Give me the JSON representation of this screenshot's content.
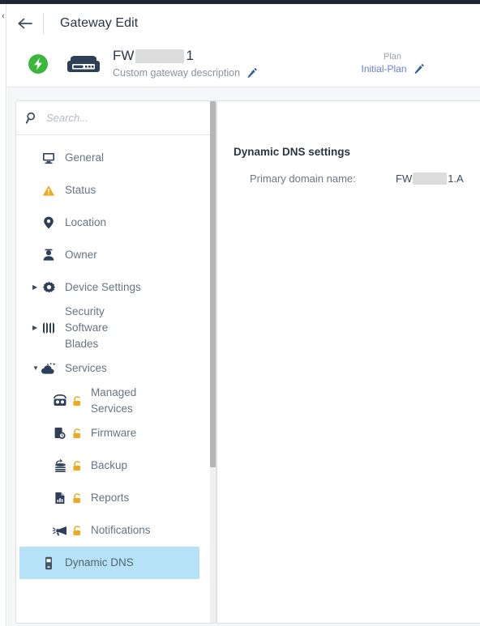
{
  "header": {
    "back_icon": "arrow-left-icon",
    "title": "Gateway Edit",
    "rail_collapse_icon": "chevron-left-icon"
  },
  "gateway": {
    "status_icon": "green-lightning-status-icon",
    "device_icon": "gateway-appliance-icon",
    "name_prefix": "FW",
    "name_suffix": "1",
    "description": "Custom gateway description",
    "description_edit_icon": "pencil-icon",
    "plan_label": "Plan",
    "plan_value": "Initial-Plan",
    "plan_edit_icon": "pencil-icon"
  },
  "sidebar": {
    "search": {
      "icon": "search-icon",
      "placeholder": "Search...",
      "value": ""
    },
    "items": [
      {
        "label": "General",
        "icon": "monitor-icon",
        "locked": false,
        "expandable": false,
        "selected": false
      },
      {
        "label": "Status",
        "icon": "warning-triangle-icon",
        "locked": false,
        "expandable": false,
        "selected": false
      },
      {
        "label": "Location",
        "icon": "map-pin-icon",
        "locked": false,
        "expandable": false,
        "selected": false
      },
      {
        "label": "Owner",
        "icon": "user-icon",
        "locked": false,
        "expandable": false,
        "selected": false
      },
      {
        "label": "Device Settings",
        "icon": "gear-icon",
        "locked": false,
        "expandable": true,
        "expanded": false,
        "selected": false
      },
      {
        "label": "Security Software Blades",
        "icon": "blades-icon",
        "locked": false,
        "expandable": true,
        "expanded": false,
        "selected": false
      },
      {
        "label": "Services",
        "icon": "cloud-services-icon",
        "locked": false,
        "expandable": true,
        "expanded": true,
        "selected": false
      }
    ],
    "sub_items": [
      {
        "label": "Managed Services",
        "icon": "managed-services-icon",
        "locked": true,
        "selected": false
      },
      {
        "label": "Firmware",
        "icon": "firmware-icon",
        "locked": true,
        "selected": false
      },
      {
        "label": "Backup",
        "icon": "backup-icon",
        "locked": true,
        "selected": false
      },
      {
        "label": "Reports",
        "icon": "reports-icon",
        "locked": true,
        "selected": false
      },
      {
        "label": "Notifications",
        "icon": "megaphone-icon",
        "locked": true,
        "selected": false
      },
      {
        "label": "Dynamic DNS",
        "icon": "dynamic-dns-icon",
        "locked": false,
        "selected": true
      }
    ]
  },
  "content": {
    "heading": "Dynamic DNS settings",
    "fields": [
      {
        "label": "Primary domain name:",
        "value_prefix": "FW",
        "value_suffix": "1.A"
      }
    ]
  },
  "colors": {
    "status_green": "#3db63d",
    "device_navy": "#2e4057",
    "lock_amber": "#f0a81e",
    "warning_amber": "#f0a81e",
    "selection_blue": "#b6e2f7",
    "link_blue": "#6a7fd0",
    "pencil_blue": "#2c5f9e",
    "text_dark": "#2a3645",
    "text_muted": "#8a939e",
    "redaction_gray": "#dcdcdc"
  }
}
